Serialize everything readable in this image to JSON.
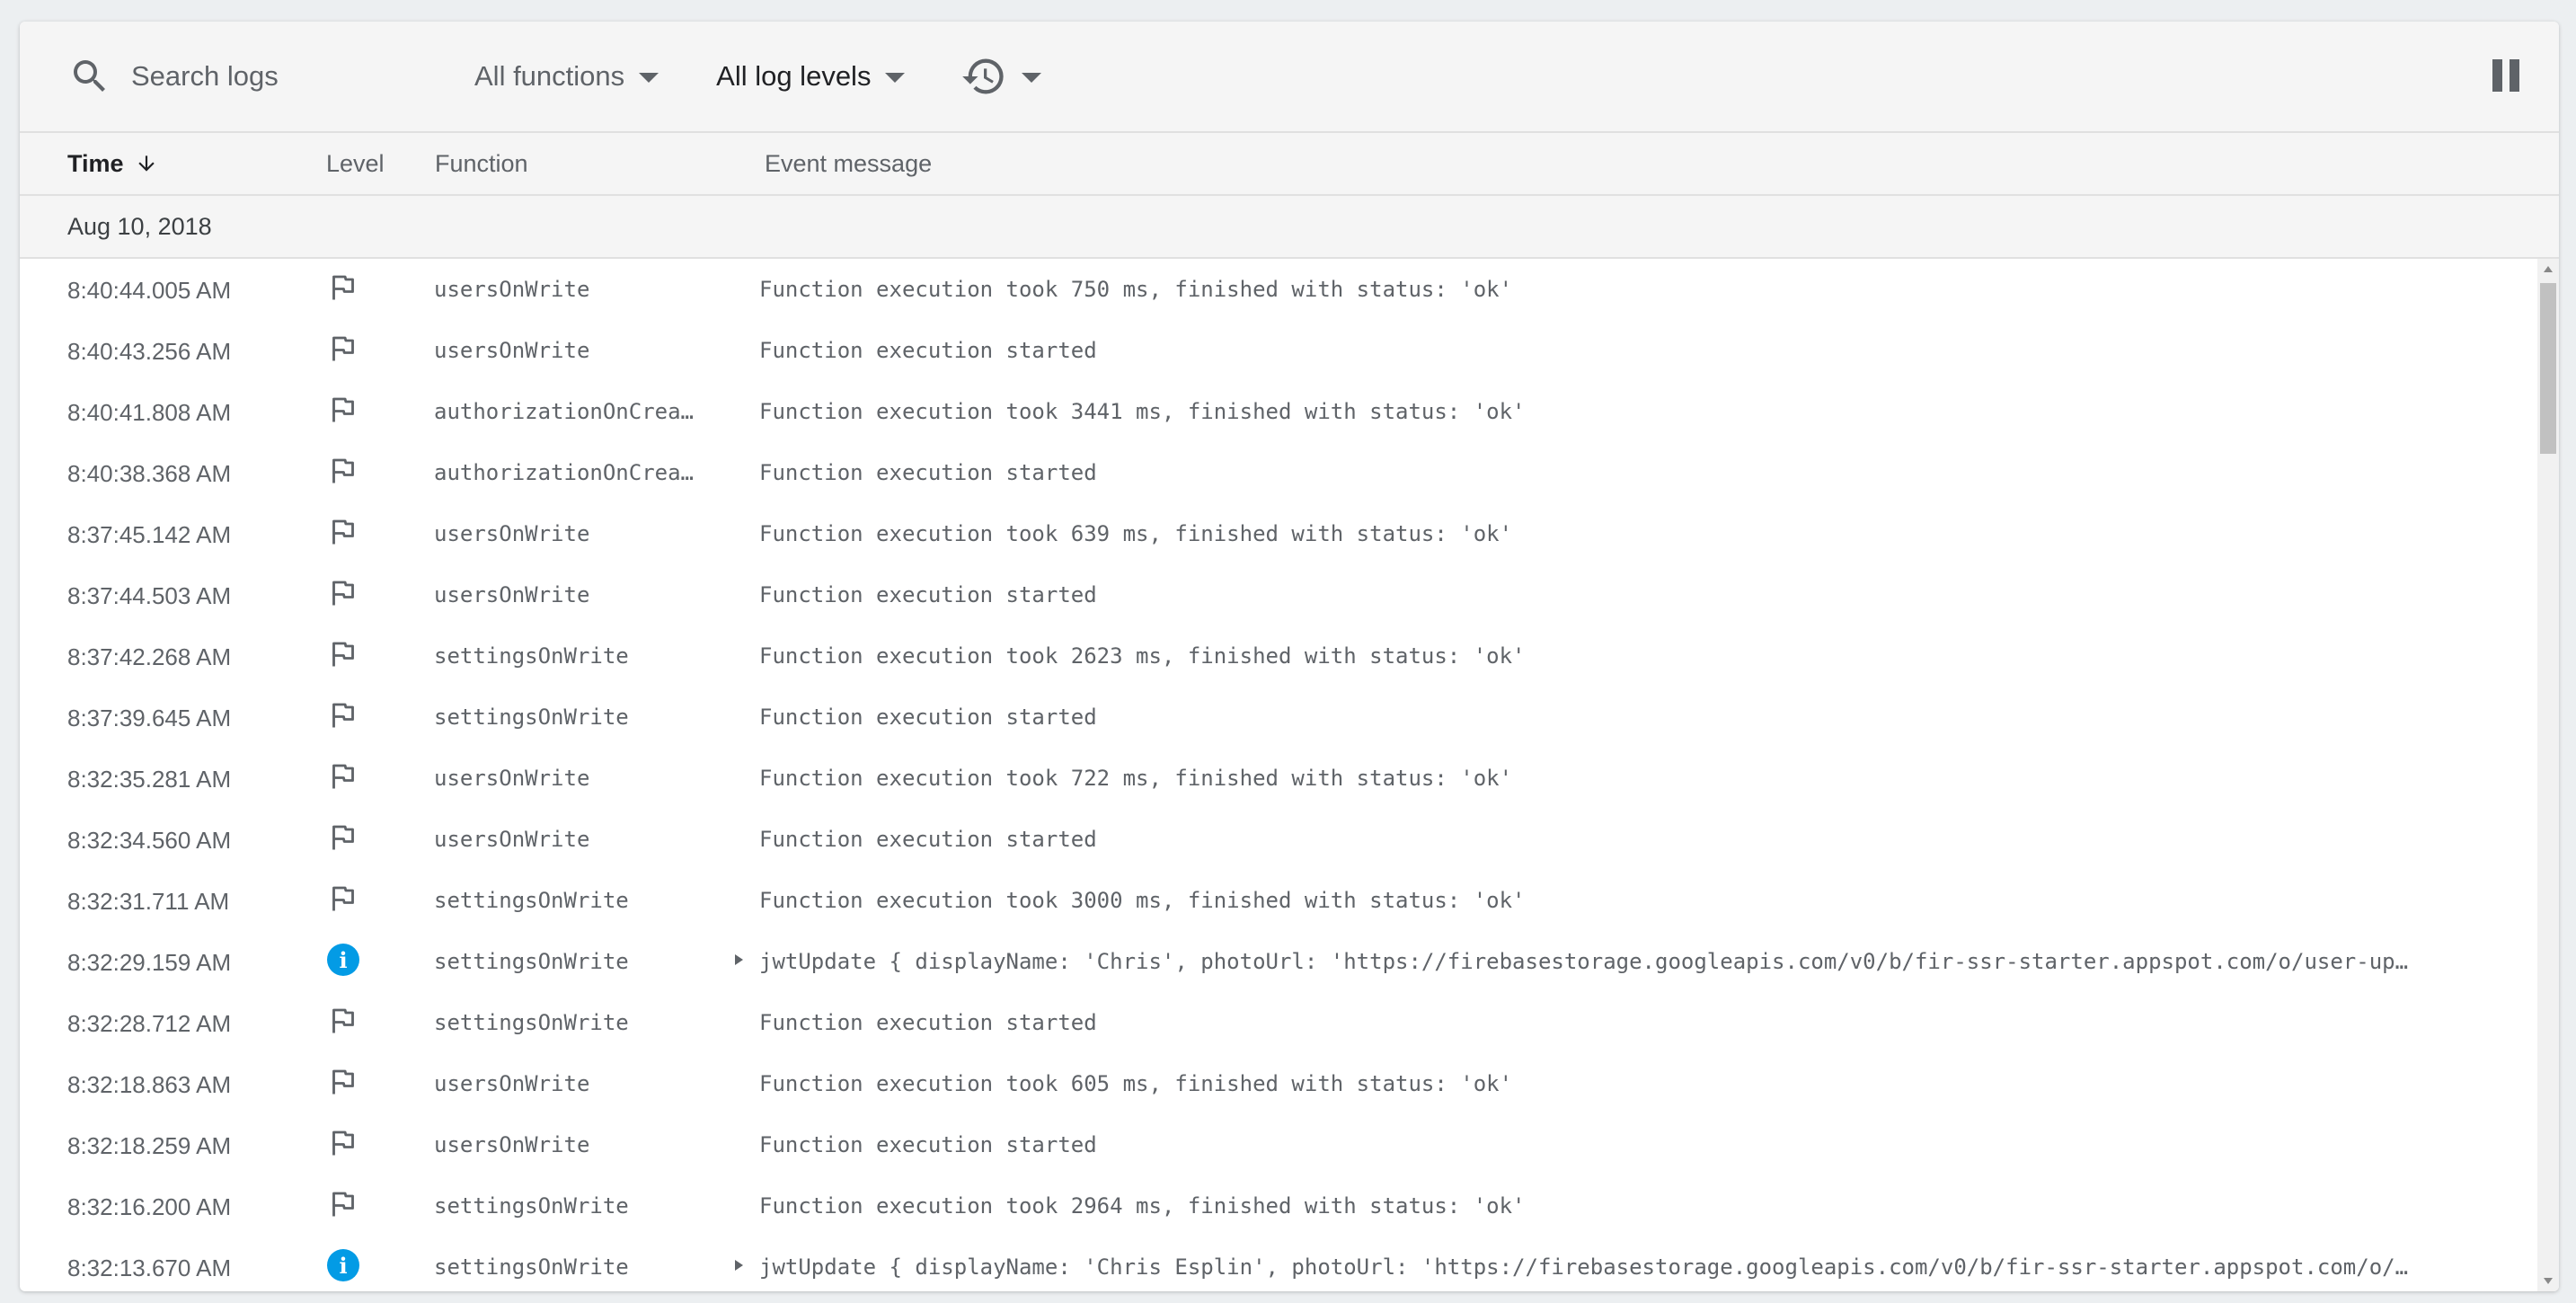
{
  "toolbar": {
    "search_placeholder": "Search logs",
    "functions_filter": "All functions",
    "levels_filter": "All log levels",
    "history_icon": "history-icon",
    "pause_icon": "pause-icon"
  },
  "columns": {
    "time": "Time",
    "level": "Level",
    "function": "Function",
    "message": "Event message"
  },
  "date_group": "Aug 10, 2018",
  "colors": {
    "info": "#039be5",
    "text_secondary": "#5f6368"
  },
  "logs": [
    {
      "time": "8:40:44.005 AM",
      "level": "flag",
      "function": "usersOnWrite",
      "message": "Function execution took 750 ms, finished with status: 'ok'"
    },
    {
      "time": "8:40:43.256 AM",
      "level": "flag",
      "function": "usersOnWrite",
      "message": "Function execution started"
    },
    {
      "time": "8:40:41.808 AM",
      "level": "flag",
      "function": "authorizationOnCrea…",
      "message": "Function execution took 3441 ms, finished with status: 'ok'"
    },
    {
      "time": "8:40:38.368 AM",
      "level": "flag",
      "function": "authorizationOnCrea…",
      "message": "Function execution started"
    },
    {
      "time": "8:37:45.142 AM",
      "level": "flag",
      "function": "usersOnWrite",
      "message": "Function execution took 639 ms, finished with status: 'ok'"
    },
    {
      "time": "8:37:44.503 AM",
      "level": "flag",
      "function": "usersOnWrite",
      "message": "Function execution started"
    },
    {
      "time": "8:37:42.268 AM",
      "level": "flag",
      "function": "settingsOnWrite",
      "message": "Function execution took 2623 ms, finished with status: 'ok'"
    },
    {
      "time": "8:37:39.645 AM",
      "level": "flag",
      "function": "settingsOnWrite",
      "message": "Function execution started"
    },
    {
      "time": "8:32:35.281 AM",
      "level": "flag",
      "function": "usersOnWrite",
      "message": "Function execution took 722 ms, finished with status: 'ok'"
    },
    {
      "time": "8:32:34.560 AM",
      "level": "flag",
      "function": "usersOnWrite",
      "message": "Function execution started"
    },
    {
      "time": "8:32:31.711 AM",
      "level": "flag",
      "function": "settingsOnWrite",
      "message": "Function execution took 3000 ms, finished with status: 'ok'"
    },
    {
      "time": "8:32:29.159 AM",
      "level": "info",
      "function": "settingsOnWrite",
      "message": "jwtUpdate { displayName: 'Chris', photoUrl: 'https://firebasestorage.googleapis.com/v0/b/fir-ssr-starter.appspot.com/o/user-up…",
      "expandable": true
    },
    {
      "time": "8:32:28.712 AM",
      "level": "flag",
      "function": "settingsOnWrite",
      "message": "Function execution started"
    },
    {
      "time": "8:32:18.863 AM",
      "level": "flag",
      "function": "usersOnWrite",
      "message": "Function execution took 605 ms, finished with status: 'ok'"
    },
    {
      "time": "8:32:18.259 AM",
      "level": "flag",
      "function": "usersOnWrite",
      "message": "Function execution started"
    },
    {
      "time": "8:32:16.200 AM",
      "level": "flag",
      "function": "settingsOnWrite",
      "message": "Function execution took 2964 ms, finished with status: 'ok'"
    },
    {
      "time": "8:32:13.670 AM",
      "level": "info",
      "function": "settingsOnWrite",
      "message": "jwtUpdate { displayName: 'Chris Esplin', photoUrl: 'https://firebasestorage.googleapis.com/v0/b/fir-ssr-starter.appspot.com/o/…",
      "expandable": true
    }
  ]
}
